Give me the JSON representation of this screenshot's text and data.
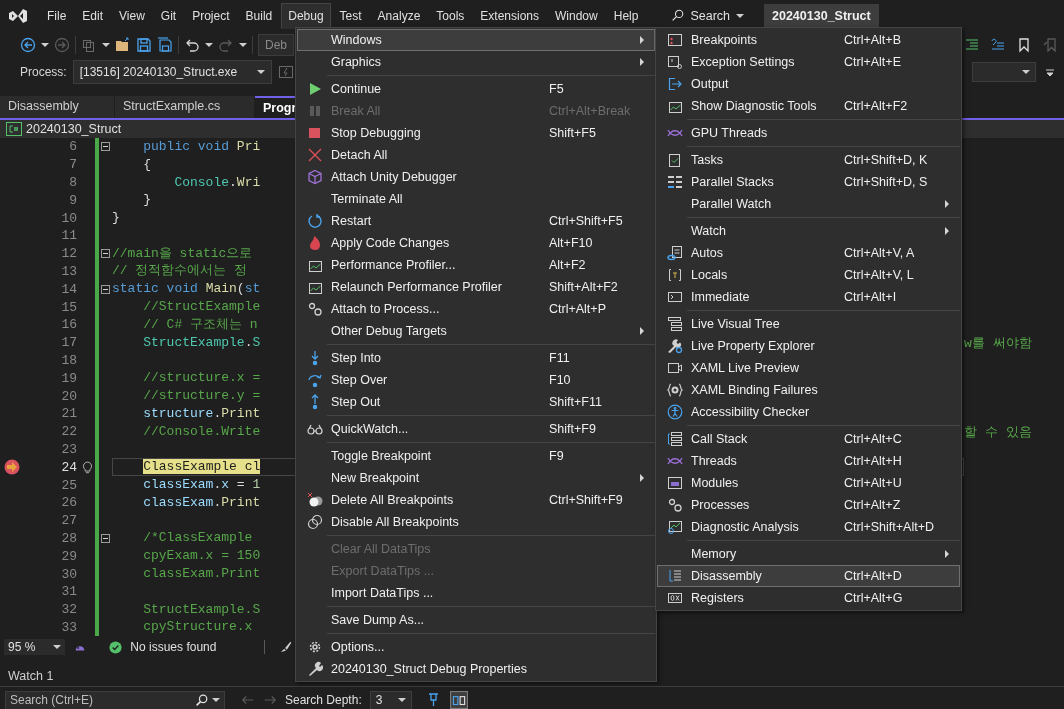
{
  "menubar": {
    "items": [
      {
        "label": "File",
        "selected": false
      },
      {
        "label": "Edit",
        "selected": false
      },
      {
        "label": "View",
        "selected": false
      },
      {
        "label": "Git",
        "selected": false
      },
      {
        "label": "Project",
        "selected": false
      },
      {
        "label": "Build",
        "selected": false
      },
      {
        "label": "Debug",
        "selected": true
      },
      {
        "label": "Test",
        "selected": false
      },
      {
        "label": "Analyze",
        "selected": false
      },
      {
        "label": "Tools",
        "selected": false
      },
      {
        "label": "Extensions",
        "selected": false
      },
      {
        "label": "Window",
        "selected": false
      },
      {
        "label": "Help",
        "selected": false
      }
    ],
    "search": "Search",
    "title": "20240130_Struct"
  },
  "toolbar": {
    "config_box": "Deb"
  },
  "process_bar": {
    "label": "Process:",
    "value": "[13516] 20240130_Struct.exe"
  },
  "doc_tabs": [
    {
      "label": "Disassembly",
      "selected": false
    },
    {
      "label": "StructExample.cs",
      "selected": false
    },
    {
      "label": "Progr",
      "selected": true
    }
  ],
  "breadcrumb": "20240130_Struct",
  "editor": {
    "lines": [
      {
        "number": "6",
        "collapsible": true,
        "tokens": [
          {
            "text": "    public void ",
            "kind": "keyword"
          },
          {
            "text": "Pri",
            "kind": "method"
          }
        ]
      },
      {
        "number": "7",
        "tokens": [
          {
            "text": "    {",
            "kind": "plain"
          }
        ]
      },
      {
        "number": "8",
        "tokens": [
          {
            "text": "        Console",
            "kind": "type"
          },
          {
            "text": ".",
            "kind": "plain"
          },
          {
            "text": "Wri",
            "kind": "method"
          }
        ]
      },
      {
        "number": "9",
        "tokens": [
          {
            "text": "    }",
            "kind": "plain"
          }
        ]
      },
      {
        "number": "10",
        "tokens": [
          {
            "text": "}",
            "kind": "plain"
          }
        ]
      },
      {
        "number": "11"
      },
      {
        "number": "12",
        "collapsible": true,
        "tokens": [
          {
            "text": "//main을 static으로",
            "kind": "comment"
          }
        ]
      },
      {
        "number": "13",
        "tokens": [
          {
            "text": "// 정적함수에서는 정",
            "kind": "comment"
          }
        ]
      },
      {
        "number": "14",
        "collapsible": true,
        "tokens": [
          {
            "text": "static void ",
            "kind": "keyword"
          },
          {
            "text": "Main",
            "kind": "method"
          },
          {
            "text": "(",
            "kind": "plain"
          },
          {
            "text": "st",
            "kind": "keyword"
          }
        ]
      },
      {
        "number": "15",
        "tokens": [
          {
            "text": "    //StructExample",
            "kind": "comment"
          }
        ]
      },
      {
        "number": "16",
        "tokens": [
          {
            "text": "    // C# 구조체는 n",
            "kind": "comment"
          }
        ]
      },
      {
        "number": "17",
        "tokens": [
          {
            "text": "    StructExample",
            "kind": "type"
          },
          {
            "text": ".",
            "kind": "plain"
          },
          {
            "text": "S",
            "kind": "type"
          }
        ],
        "tail": "w를 써야함"
      },
      {
        "number": "18"
      },
      {
        "number": "19",
        "tokens": [
          {
            "text": "    //structure.x =",
            "kind": "comment"
          }
        ]
      },
      {
        "number": "20",
        "tokens": [
          {
            "text": "    //structure.y =",
            "kind": "comment"
          }
        ]
      },
      {
        "number": "21",
        "tokens": [
          {
            "text": "    structure",
            "kind": "ident"
          },
          {
            "text": ".",
            "kind": "plain"
          },
          {
            "text": "Print",
            "kind": "method"
          }
        ]
      },
      {
        "number": "22",
        "tokens": [
          {
            "text": "    //Console.Write",
            "kind": "comment"
          }
        ],
        "tail": "할 수 있음"
      },
      {
        "number": "23"
      },
      {
        "number": "24",
        "current": true,
        "tokens": [
          {
            "text": "    ClassExample cl",
            "kind": "plain"
          }
        ]
      },
      {
        "number": "25",
        "tokens": [
          {
            "text": "    classExam",
            "kind": "ident"
          },
          {
            "text": ".",
            "kind": "plain"
          },
          {
            "text": "x",
            "kind": "ident"
          },
          {
            "text": " = ",
            "kind": "plain"
          },
          {
            "text": "1",
            "kind": "number"
          }
        ]
      },
      {
        "number": "26",
        "tokens": [
          {
            "text": "    classExam",
            "kind": "ident"
          },
          {
            "text": ".",
            "kind": "plain"
          },
          {
            "text": "Print",
            "kind": "method"
          }
        ]
      },
      {
        "number": "27"
      },
      {
        "number": "28",
        "collapsible": true,
        "tokens": [
          {
            "text": "    /*ClassExample",
            "kind": "comment"
          }
        ]
      },
      {
        "number": "29",
        "tokens": [
          {
            "text": "    cpyExam.x = 150",
            "kind": "comment"
          }
        ]
      },
      {
        "number": "30",
        "tokens": [
          {
            "text": "    classExam.Print",
            "kind": "comment"
          }
        ]
      },
      {
        "number": "31"
      },
      {
        "number": "32",
        "tokens": [
          {
            "text": "    StructExample.S",
            "kind": "comment"
          }
        ]
      },
      {
        "number": "33",
        "tokens": [
          {
            "text": "    cpyStructure.x",
            "kind": "comment"
          }
        ]
      }
    ]
  },
  "status_bar": {
    "zoom": "95 %",
    "issues": "No issues found"
  },
  "watch": {
    "tab": "Watch 1",
    "search_placeholder": "Search (Ctrl+E)",
    "depth_label": "Search Depth:",
    "depth": "3"
  },
  "debug_menu": [
    {
      "kind": "item",
      "label": "Windows",
      "submenu": true,
      "selected": true,
      "disabled": false
    },
    {
      "kind": "item",
      "label": "Graphics",
      "submenu": true,
      "selected": false,
      "disabled": false
    },
    {
      "kind": "separator"
    },
    {
      "kind": "item",
      "label": "Continue",
      "shortcut": "F5",
      "selected": false,
      "disabled": false
    },
    {
      "kind": "item",
      "label": "Break All",
      "shortcut": "Ctrl+Alt+Break",
      "selected": false,
      "disabled": true
    },
    {
      "kind": "item",
      "label": "Stop Debugging",
      "shortcut": "Shift+F5",
      "selected": false,
      "disabled": false
    },
    {
      "kind": "item",
      "label": "Detach All",
      "selected": false,
      "disabled": false
    },
    {
      "kind": "item",
      "label": "Attach Unity Debugger",
      "selected": false,
      "disabled": false
    },
    {
      "kind": "item",
      "label": "Terminate All",
      "selected": false,
      "disabled": false
    },
    {
      "kind": "item",
      "label": "Restart",
      "shortcut": "Ctrl+Shift+F5",
      "selected": false,
      "disabled": false
    },
    {
      "kind": "item",
      "label": "Apply Code Changes",
      "shortcut": "Alt+F10",
      "selected": false,
      "disabled": false
    },
    {
      "kind": "item",
      "label": "Performance Profiler...",
      "shortcut": "Alt+F2",
      "selected": false,
      "disabled": false
    },
    {
      "kind": "item",
      "label": "Relaunch Performance Profiler",
      "shortcut": "Shift+Alt+F2",
      "selected": false,
      "disabled": false
    },
    {
      "kind": "item",
      "label": "Attach to Process...",
      "shortcut": "Ctrl+Alt+P",
      "selected": false,
      "disabled": false
    },
    {
      "kind": "item",
      "label": "Other Debug Targets",
      "submenu": true,
      "selected": false,
      "disabled": false
    },
    {
      "kind": "separator"
    },
    {
      "kind": "item",
      "label": "Step Into",
      "shortcut": "F11",
      "selected": false,
      "disabled": false
    },
    {
      "kind": "item",
      "label": "Step Over",
      "shortcut": "F10",
      "selected": false,
      "disabled": false
    },
    {
      "kind": "item",
      "label": "Step Out",
      "shortcut": "Shift+F11",
      "selected": false,
      "disabled": false
    },
    {
      "kind": "separator"
    },
    {
      "kind": "item",
      "label": "QuickWatch...",
      "shortcut": "Shift+F9",
      "selected": false,
      "disabled": false
    },
    {
      "kind": "separator"
    },
    {
      "kind": "item",
      "label": "Toggle Breakpoint",
      "shortcut": "F9",
      "selected": false,
      "disabled": false
    },
    {
      "kind": "item",
      "label": "New Breakpoint",
      "submenu": true,
      "selected": false,
      "disabled": false
    },
    {
      "kind": "item",
      "label": "Delete All Breakpoints",
      "shortcut": "Ctrl+Shift+F9",
      "selected": false,
      "disabled": false
    },
    {
      "kind": "item",
      "label": "Disable All Breakpoints",
      "selected": false,
      "disabled": false
    },
    {
      "kind": "separator"
    },
    {
      "kind": "item",
      "label": "Clear All DataTips",
      "selected": false,
      "disabled": true
    },
    {
      "kind": "item",
      "label": "Export DataTips ...",
      "selected": false,
      "disabled": true
    },
    {
      "kind": "item",
      "label": "Import DataTips ...",
      "selected": false,
      "disabled": false
    },
    {
      "kind": "separator"
    },
    {
      "kind": "item",
      "label": "Save Dump As...",
      "selected": false,
      "disabled": false
    },
    {
      "kind": "separator"
    },
    {
      "kind": "item",
      "label": "Options...",
      "selected": false,
      "disabled": false
    },
    {
      "kind": "item",
      "label": "20240130_Struct Debug Properties",
      "selected": false,
      "disabled": false
    }
  ],
  "windows_submenu": [
    {
      "kind": "item",
      "label": "Breakpoints",
      "shortcut": "Ctrl+Alt+B",
      "selected": false
    },
    {
      "kind": "item",
      "label": "Exception Settings",
      "shortcut": "Ctrl+Alt+E",
      "selected": false
    },
    {
      "kind": "item",
      "label": "Output",
      "selected": false
    },
    {
      "kind": "item",
      "label": "Show Diagnostic Tools",
      "shortcut": "Ctrl+Alt+F2",
      "selected": false
    },
    {
      "kind": "separator"
    },
    {
      "kind": "item",
      "label": "GPU Threads",
      "selected": false
    },
    {
      "kind": "separator"
    },
    {
      "kind": "item",
      "label": "Tasks",
      "shortcut": "Ctrl+Shift+D, K",
      "selected": false
    },
    {
      "kind": "item",
      "label": "Parallel Stacks",
      "shortcut": "Ctrl+Shift+D, S",
      "selected": false
    },
    {
      "kind": "item",
      "label": "Parallel Watch",
      "submenu": true,
      "selected": false
    },
    {
      "kind": "separator"
    },
    {
      "kind": "item",
      "label": "Watch",
      "submenu": true,
      "selected": false
    },
    {
      "kind": "item",
      "label": "Autos",
      "shortcut": "Ctrl+Alt+V, A",
      "selected": false
    },
    {
      "kind": "item",
      "label": "Locals",
      "shortcut": "Ctrl+Alt+V, L",
      "selected": false
    },
    {
      "kind": "item",
      "label": "Immediate",
      "shortcut": "Ctrl+Alt+I",
      "selected": false
    },
    {
      "kind": "separator"
    },
    {
      "kind": "item",
      "label": "Live Visual Tree",
      "selected": false
    },
    {
      "kind": "item",
      "label": "Live Property Explorer",
      "selected": false
    },
    {
      "kind": "item",
      "label": "XAML Live Preview",
      "selected": false
    },
    {
      "kind": "item",
      "label": "XAML Binding Failures",
      "selected": false
    },
    {
      "kind": "item",
      "label": "Accessibility Checker",
      "selected": false
    },
    {
      "kind": "separator"
    },
    {
      "kind": "item",
      "label": "Call Stack",
      "shortcut": "Ctrl+Alt+C",
      "selected": false
    },
    {
      "kind": "item",
      "label": "Threads",
      "shortcut": "Ctrl+Alt+H",
      "selected": false
    },
    {
      "kind": "item",
      "label": "Modules",
      "shortcut": "Ctrl+Alt+U",
      "selected": false
    },
    {
      "kind": "item",
      "label": "Processes",
      "shortcut": "Ctrl+Alt+Z",
      "selected": false
    },
    {
      "kind": "item",
      "label": "Diagnostic Analysis",
      "shortcut": "Ctrl+Shift+Alt+D",
      "selected": false
    },
    {
      "kind": "separator"
    },
    {
      "kind": "item",
      "label": "Memory",
      "submenu": true,
      "selected": false
    },
    {
      "kind": "item",
      "label": "Disassembly",
      "shortcut": "Ctrl+Alt+D",
      "selected": true
    },
    {
      "kind": "item",
      "label": "Registers",
      "shortcut": "Ctrl+Alt+G",
      "selected": false
    }
  ]
}
